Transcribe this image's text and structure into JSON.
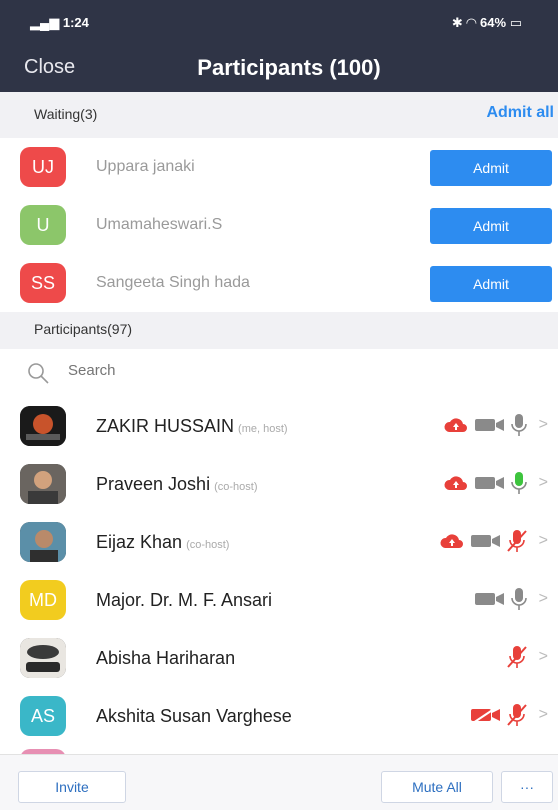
{
  "status_bar": {
    "time": "1:24",
    "battery": "64%"
  },
  "header": {
    "close_label": "Close",
    "title": "Participants (100)"
  },
  "waiting": {
    "label": "Waiting(3)",
    "admit_all": "Admit all",
    "users": [
      {
        "initials": "UJ",
        "name": "Uppara janaki",
        "color": "#ee4a4a",
        "admit_label": "Admit"
      },
      {
        "initials": "U",
        "name": "Umamaheswari.S",
        "color": "#8cc66a",
        "admit_label": "Admit"
      },
      {
        "initials": "SS",
        "name": "Sangeeta Singh hada",
        "color": "#ee4a4a",
        "admit_label": "Admit"
      }
    ]
  },
  "participants": {
    "label": "Participants(97)",
    "search_placeholder": "Search",
    "users": [
      {
        "name": "ZAKIR HUSSAIN",
        "role": "(me, host)",
        "initials": "",
        "color": "#1a1a1a",
        "recording": true,
        "video": "off",
        "mic": "on"
      },
      {
        "name": "Praveen Joshi",
        "role": "(co-host)",
        "initials": "",
        "color": "#6a6560",
        "recording": true,
        "video": "off",
        "mic": "speaking"
      },
      {
        "name": "Eijaz Khan",
        "role": "(co-host)",
        "initials": "",
        "color": "#5b8fa8",
        "recording": true,
        "video": "off",
        "mic": "muted"
      },
      {
        "name": "Major. Dr. M. F. Ansari",
        "role": "",
        "initials": "MD",
        "color": "#f2cc1f",
        "recording": false,
        "video": "off",
        "mic": "on"
      },
      {
        "name": "Abisha Hariharan",
        "role": "",
        "initials": "",
        "color": "#555",
        "recording": false,
        "video": "none",
        "mic": "muted"
      },
      {
        "name": "Akshita Susan Varghese",
        "role": "",
        "initials": "AS",
        "color": "#3ab7c8",
        "recording": false,
        "video": "muted",
        "mic": "muted"
      }
    ]
  },
  "footer": {
    "invite_label": "Invite",
    "mute_all_label": "Mute All",
    "more_label": "···"
  }
}
